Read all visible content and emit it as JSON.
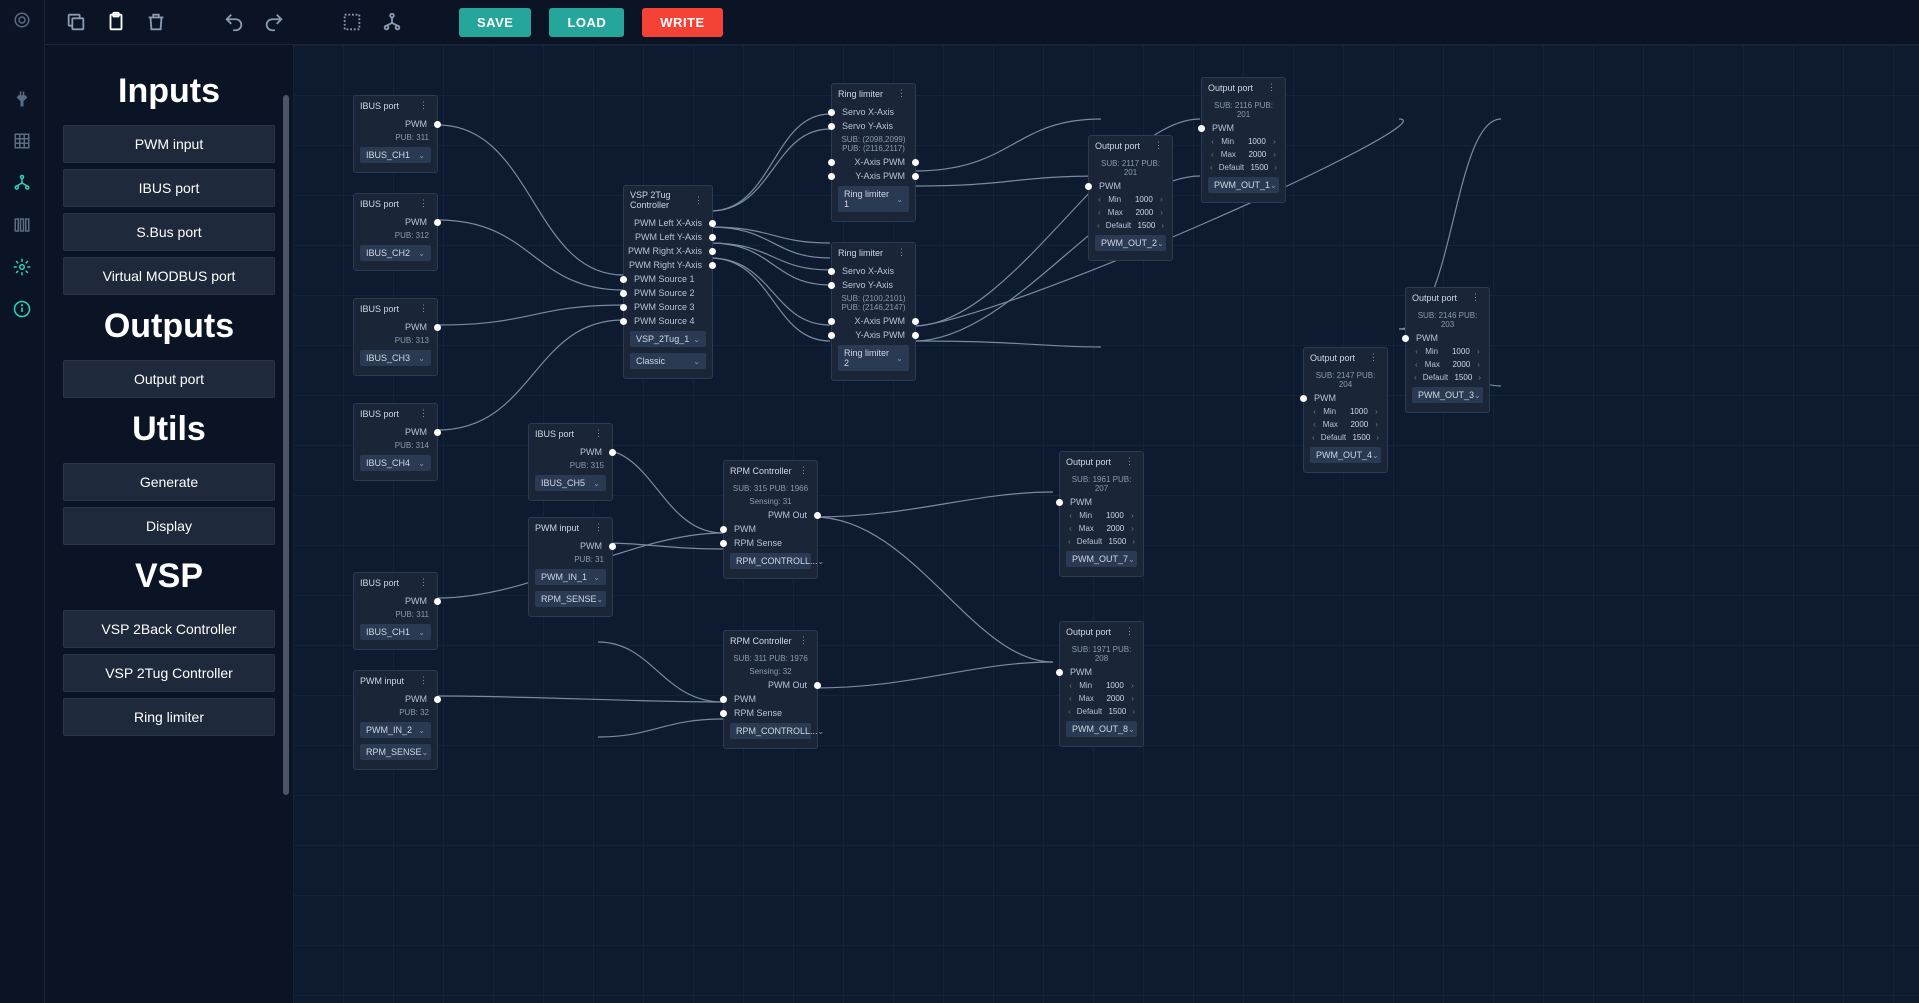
{
  "toolbar": {
    "save": "SAVE",
    "load": "LOAD",
    "write": "WRITE"
  },
  "rail": {
    "icons": [
      "logo",
      "plug",
      "grid",
      "tree",
      "columns",
      "gear",
      "info"
    ]
  },
  "palette": {
    "sections": [
      {
        "title": "Inputs",
        "items": [
          "PWM input",
          "IBUS port",
          "S.Bus port",
          "Virtual MODBUS port"
        ]
      },
      {
        "title": "Outputs",
        "items": [
          "Output port"
        ]
      },
      {
        "title": "Utils",
        "items": [
          "Generate",
          "Display"
        ]
      },
      {
        "title": "VSP",
        "items": [
          "VSP 2Back Controller",
          "VSP 2Tug Controller",
          "Ring limiter"
        ]
      }
    ]
  },
  "nodes": {
    "ibus1": {
      "title": "IBUS port",
      "port": "PWM",
      "pub": "PUB: 311",
      "select": "IBUS_CH1"
    },
    "ibus2": {
      "title": "IBUS port",
      "port": "PWM",
      "pub": "PUB: 312",
      "select": "IBUS_CH2"
    },
    "ibus3": {
      "title": "IBUS port",
      "port": "PWM",
      "pub": "PUB: 313",
      "select": "IBUS_CH3"
    },
    "ibus4": {
      "title": "IBUS port",
      "port": "PWM",
      "pub": "PUB: 314",
      "select": "IBUS_CH4"
    },
    "ibus5": {
      "title": "IBUS port",
      "port": "PWM",
      "pub": "PUB: 315",
      "select": "IBUS_CH5"
    },
    "ibus6": {
      "title": "IBUS port",
      "port": "PWM",
      "pub": "PUB: 311",
      "select": "IBUS_CH1"
    },
    "pwmin1": {
      "title": "PWM input",
      "port": "PWM",
      "pub": "PUB: 31",
      "select1": "PWM_IN_1",
      "select2": "RPM_SENSE"
    },
    "pwmin2": {
      "title": "PWM input",
      "port": "PWM",
      "pub": "PUB: 32",
      "select1": "PWM_IN_2",
      "select2": "RPM_SENSE"
    },
    "vsp": {
      "title": "VSP 2Tug Controller",
      "ports_out": [
        "PWM Left X-Axis",
        "PWM Left Y-Axis",
        "PWM Right X-Axis",
        "PWM Right Y-Axis"
      ],
      "ports_in": [
        "PWM Source 1",
        "PWM Source 2",
        "PWM Source 3",
        "PWM Source 4"
      ],
      "select1": "VSP_2Tug_1",
      "select2": "Classic"
    },
    "ring1": {
      "title": "Ring limiter",
      "ins": [
        "Servo X-Axis",
        "Servo Y-Axis"
      ],
      "sub": "SUB: (2098,2099) PUB: (2116,2117)",
      "outs": [
        "X-Axis PWM",
        "Y-Axis PWM"
      ],
      "select": "Ring limiter 1"
    },
    "ring2": {
      "title": "Ring limiter",
      "ins": [
        "Servo X-Axis",
        "Servo Y-Axis"
      ],
      "sub": "SUB: (2100,2101) PUB: (2146,2147)",
      "outs": [
        "X-Axis PWM",
        "Y-Axis PWM"
      ],
      "select": "Ring limiter 2"
    },
    "rpm1": {
      "title": "RPM Controller",
      "sub": "SUB: 315 PUB: 1966",
      "sense": "Sensing: 31",
      "out": "PWM Out",
      "ins": [
        "PWM",
        "RPM Sense"
      ],
      "select": "RPM_CONTROLL..."
    },
    "rpm2": {
      "title": "RPM Controller",
      "sub": "SUB: 311 PUB: 1976",
      "sense": "Sensing: 32",
      "out": "PWM Out",
      "ins": [
        "PWM",
        "RPM Sense"
      ],
      "select": "RPM_CONTROLL..."
    },
    "out1": {
      "title": "Output port",
      "sub": "SUB: 2116 PUB: 201",
      "in": "PWM",
      "params": [
        [
          "Min",
          "1000"
        ],
        [
          "Max",
          "2000"
        ],
        [
          "Default",
          "1500"
        ]
      ],
      "select": "PWM_OUT_1"
    },
    "out2": {
      "title": "Output port",
      "sub": "SUB: 2117 PUB: 201",
      "in": "PWM",
      "params": [
        [
          "Min",
          "1000"
        ],
        [
          "Max",
          "2000"
        ],
        [
          "Default",
          "1500"
        ]
      ],
      "select": "PWM_OUT_2"
    },
    "out3": {
      "title": "Output port",
      "sub": "SUB: 2146 PUB: 203",
      "in": "PWM",
      "params": [
        [
          "Min",
          "1000"
        ],
        [
          "Max",
          "2000"
        ],
        [
          "Default",
          "1500"
        ]
      ],
      "select": "PWM_OUT_3"
    },
    "out4": {
      "title": "Output port",
      "sub": "SUB: 2147 PUB: 204",
      "in": "PWM",
      "params": [
        [
          "Min",
          "1000"
        ],
        [
          "Max",
          "2000"
        ],
        [
          "Default",
          "1500"
        ]
      ],
      "select": "PWM_OUT_4"
    },
    "out7": {
      "title": "Output port",
      "sub": "SUB: 1961 PUB: 207",
      "in": "PWM",
      "params": [
        [
          "Min",
          "1000"
        ],
        [
          "Max",
          "2000"
        ],
        [
          "Default",
          "1500"
        ]
      ],
      "select": "PWM_OUT_7"
    },
    "out8": {
      "title": "Output port",
      "sub": "SUB: 1971 PUB: 208",
      "in": "PWM",
      "params": [
        [
          "Min",
          "1000"
        ],
        [
          "Max",
          "2000"
        ],
        [
          "Default",
          "1500"
        ]
      ],
      "select": "PWM_OUT_8"
    }
  }
}
